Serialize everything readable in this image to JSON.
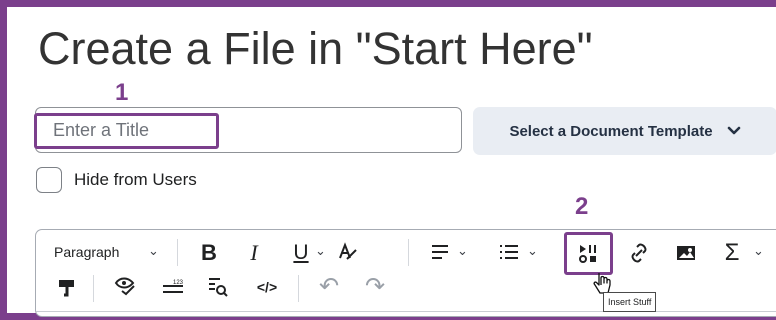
{
  "title": "Create a File in \"Start Here\"",
  "callouts": {
    "one": "1",
    "two": "2"
  },
  "title_input": {
    "placeholder": "Enter a Title",
    "value": ""
  },
  "template_select": {
    "label": "Select a Document Template",
    "icon": "chevron-down-icon"
  },
  "visibility": {
    "label": "Hide from Users",
    "checked": false
  },
  "toolbar": {
    "paragraph_label": "Paragraph",
    "bold_label": "B",
    "italic_label": "I",
    "underline_label": "U",
    "tooltip": "Insert Stuff",
    "icons": [
      "paragraph-dropdown",
      "bold-icon",
      "italic-icon",
      "underline-icon",
      "text-color-icon",
      "align-icon",
      "list-icon",
      "insert-stuff-icon",
      "link-icon",
      "image-icon",
      "equation-icon",
      "format-painter-icon",
      "accessibility-checker-icon",
      "word-count-icon",
      "find-replace-icon",
      "source-code-icon",
      "undo-icon",
      "redo-icon"
    ]
  },
  "colors": {
    "accent": "#7b3f8c",
    "button_background": "#e9edf3",
    "border": "#a6abb3",
    "text": "#202122"
  }
}
